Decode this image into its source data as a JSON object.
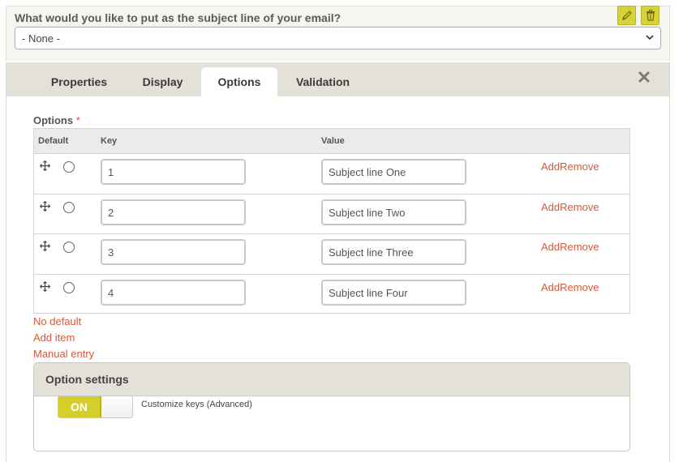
{
  "question": {
    "label": "What would you like to put as the subject line of your email?",
    "select_value": "- None -",
    "edit_icon": "pencil-icon",
    "delete_icon": "trash-icon"
  },
  "tabs": [
    {
      "label": "Properties",
      "active": false
    },
    {
      "label": "Display",
      "active": false
    },
    {
      "label": "Options",
      "active": true
    },
    {
      "label": "Validation",
      "active": false
    }
  ],
  "options": {
    "label": "Options",
    "required_mark": "*",
    "columns": {
      "default": "Default",
      "key": "Key",
      "value": "Value"
    },
    "rows": [
      {
        "key": "1",
        "value": "Subject line One",
        "add": "Add",
        "remove": "Remove"
      },
      {
        "key": "2",
        "value": "Subject line Two",
        "add": "Add",
        "remove": "Remove"
      },
      {
        "key": "3",
        "value": "Subject line Three",
        "add": "Add",
        "remove": "Remove"
      },
      {
        "key": "4",
        "value": "Subject line Four",
        "add": "Add",
        "remove": "Remove"
      }
    ],
    "links": {
      "no_default": "No default",
      "add_item": "Add item",
      "manual_entry": "Manual entry"
    }
  },
  "option_settings": {
    "title": "Option settings",
    "toggle_label": "ON",
    "toggle_on": true,
    "customize_label": "Customize keys (Advanced)"
  },
  "colors": {
    "accent": "#d4cf2a",
    "link": "#d45a3a",
    "panel": "#e4e1d9"
  }
}
